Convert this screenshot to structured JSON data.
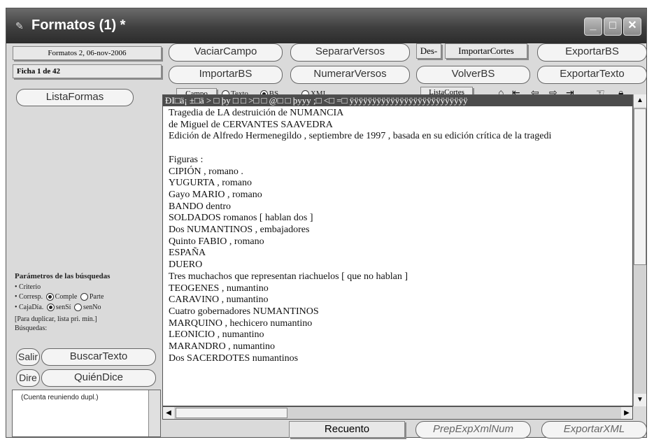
{
  "window": {
    "title": "Formatos (1) *"
  },
  "left_tabs": {
    "date": "Formatos 2, 06-nov-2006",
    "record": "Ficha 1 de 42"
  },
  "buttons": {
    "lista_formas": "ListaFormas",
    "vaciar_campo": "VaciarCampo",
    "separar_versos": "SepararVersos",
    "des": "Des-",
    "importar_cortes": "ImportarCortes",
    "exportar_bs": "ExportarBS",
    "importar_bs": "ImportarBS",
    "numerar_versos": "NumerarVersos",
    "volver_bs": "VolverBS",
    "exportar_texto": "ExportarTexto",
    "lista_cortes": "ListaCortes",
    "salir": "Salir",
    "buscar_texto": "BuscarTexto",
    "dire": "Dire",
    "quien_dice": "QuiénDice",
    "recuento": "Recuento",
    "prep_exp": "PrepExpXmlNum",
    "exportar_xml": "ExportarXML"
  },
  "campo": {
    "label": "Campo",
    "options": [
      "Texto",
      "BS",
      "XML"
    ],
    "selected": "BS"
  },
  "params": {
    "title": "Parámetros de las búsquedas",
    "criterio": "• Criterio",
    "corresp_label": "• Corresp.",
    "corresp_opt1": "Comple",
    "corresp_opt2": "Parte",
    "cajadia_label": "• CajaDía.",
    "cajadia_opt1": "senSí",
    "cajadia_opt2": "senNo",
    "note": "[Para duplicar, lista pri. mín.]",
    "busquedas": "Búsquedas:"
  },
  "listbox_text": "(Cuenta reuniendo dupl.)",
  "content": {
    "header_garbled": "ÐI□ä¡ ±□ä   > □ þy     □   □ >□  □ @□ □ þyyy  ;□ <□ =□ ÿÿÿÿÿÿÿÿÿÿÿÿÿÿÿÿÿÿÿÿÿÿÿÿÿÿ",
    "lines": [
      "Tragedia de LA destruición de NUMANCIA",
      "de Miguel de CERVANTES SAAVEDRA",
      "Edición de Alfredo Hermenegildo , septiembre de 1997 , basada en su edición crítica de la tragedi",
      "",
      "Figuras :",
      "CIPIÓN , romano .",
      "YUGURTA , romano",
      "Gayo MARIO , romano",
      "BANDO dentro",
      "SOLDADOS romanos [ hablan dos ]",
      "Dos NUMANTINOS , embajadores",
      "Quinto FABIO , romano",
      "ESPAÑA",
      "DUERO",
      "Tres muchachos que representan riachuelos [ que no hablan ]",
      "TEOGENES , numantino",
      "CARAVINO , numantino",
      "Cuatro gobernadores NUMANTINOS",
      "MARQUINO , hechicero numantino",
      "LEONICIO , numantino",
      "MARANDRO , numantino",
      "Dos SACERDOTES numantinos"
    ]
  },
  "icons": [
    "house-icon",
    "first-record-icon",
    "prev-record-icon",
    "next-record-icon",
    "last-record-icon",
    "hand-icon",
    "lock-icon"
  ]
}
